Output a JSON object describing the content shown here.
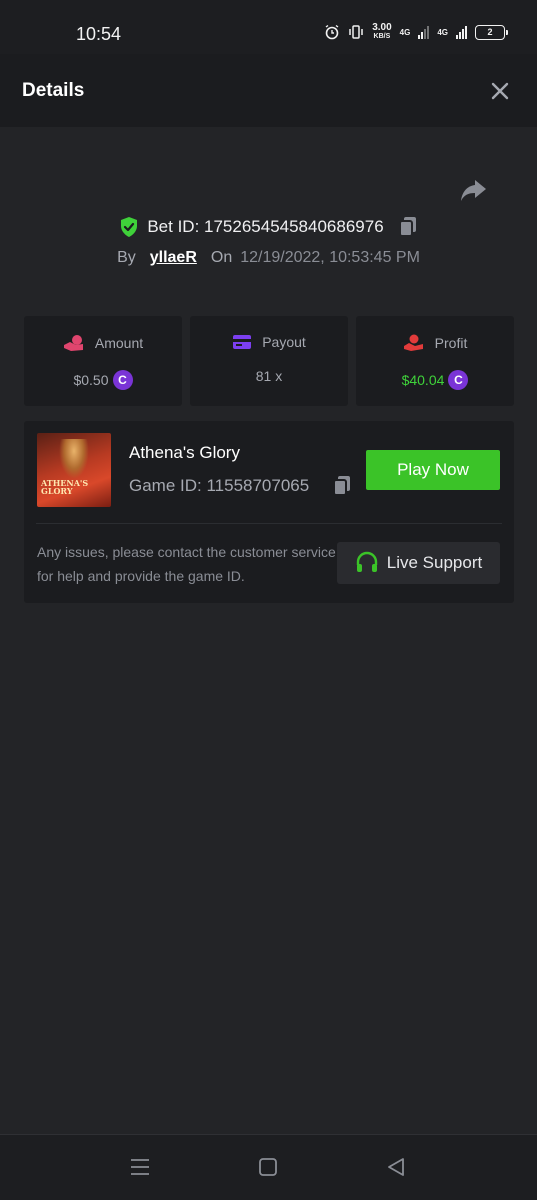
{
  "status_bar": {
    "time": "10:54",
    "net_speed_value": "3.00",
    "net_speed_unit": "KB/S",
    "network_label_1": "4G",
    "network_label_2": "4G",
    "battery_level": "2"
  },
  "header": {
    "title": "Details"
  },
  "bet": {
    "id_text": "Bet ID: 1752654545840686976",
    "by_label": "By",
    "username": "yllaeR",
    "on_label": "On",
    "datetime": "12/19/2022, 10:53:45 PM"
  },
  "stats": {
    "amount": {
      "label": "Amount",
      "value": "$0.50"
    },
    "payout": {
      "label": "Payout",
      "value": "81 x"
    },
    "profit": {
      "label": "Profit",
      "value": "$40.04"
    },
    "coin_symbol": "C"
  },
  "game": {
    "name": "Athena's Glory",
    "id_text": "Game ID: 11558707065",
    "thumbnail_text": "ATHENA'S GLORY",
    "play_label": "Play Now",
    "support_text": "Any issues, please contact the customer service for help and provide the game ID.",
    "support_label": "Live Support"
  },
  "colors": {
    "accent_green": "#3bc328",
    "profit_green": "#3fd13a",
    "coin_purple": "#7a34d6",
    "amount_pink": "#e0456e",
    "payout_purple": "#7c3ff0",
    "profit_red": "#e23b3b"
  },
  "icons": {
    "close": "close-icon",
    "share": "share-icon",
    "shield": "shield-check-icon",
    "copy": "copy-icon",
    "amount": "coins-hand-icon",
    "payout": "card-icon",
    "profit": "money-hand-icon",
    "support": "headset-icon"
  }
}
